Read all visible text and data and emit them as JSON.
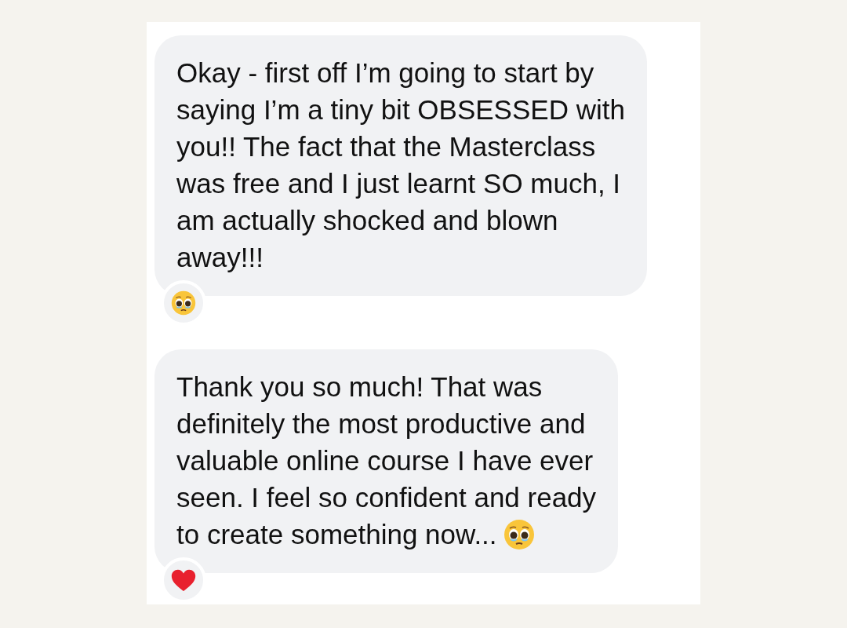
{
  "messages": [
    {
      "lines": [
        "Okay - first off I’m going to start by",
        "saying I’m a tiny bit OBSESSED with",
        "you!! The fact that the Masterclass",
        "was free and I just learnt SO much, I",
        "am actually shocked and blown",
        "away!!!"
      ],
      "reaction": {
        "kind": "teary-face"
      }
    },
    {
      "lines": [
        "Thank you so much! That was",
        "definitely the most productive and",
        "valuable online course I have ever",
        "seen. I feel so confident and ready",
        "to create something now..."
      ],
      "trailing_emoji": {
        "kind": "teary-face"
      },
      "reaction": {
        "kind": "heart"
      }
    }
  ]
}
